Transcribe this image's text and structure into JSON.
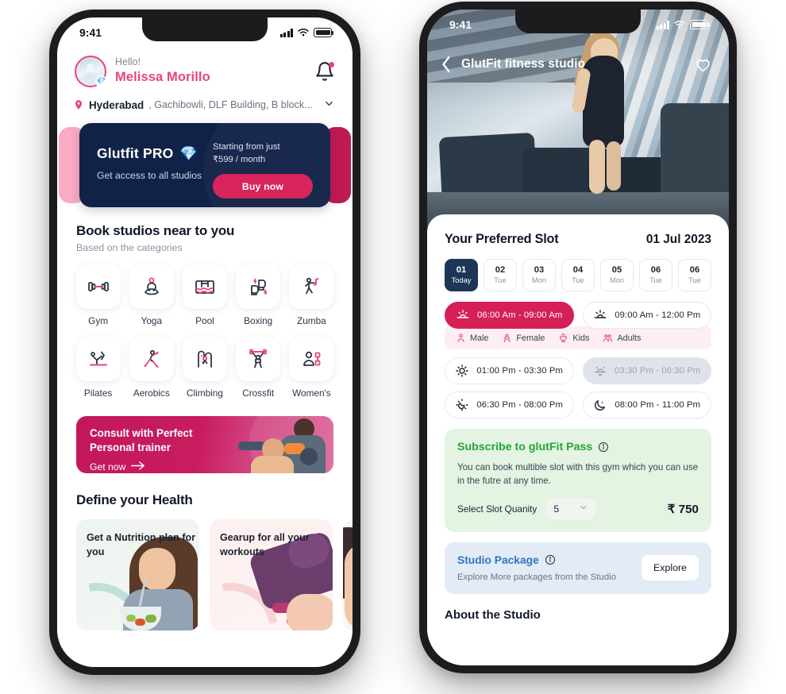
{
  "home": {
    "statusbar": {
      "time": "9:41",
      "signal_icon": "signal-bars-icon",
      "wifi_icon": "wifi-icon",
      "battery_icon": "battery-icon"
    },
    "greeting": {
      "hello": "Hello!",
      "name": "Melissa Morillo",
      "avatar_icon": "avatar",
      "badge_icon": "diamond-badge-icon",
      "bell_icon": "notification-bell-icon"
    },
    "location": {
      "pin_icon": "location-pin-icon",
      "city": "Hyderabad",
      "rest": ", Gachibowli, DLF Building, B block...",
      "chevron_icon": "chevron-down-icon"
    },
    "promo": {
      "title": "Glutfit PRO",
      "emoji": "💎",
      "subtitle": "Get access to all studios",
      "price_line1": "Starting from just",
      "price_line2": "₹599 / month",
      "buy_label": "Buy now"
    },
    "book_section": {
      "title": "Book studios near to you",
      "subtitle": "Based on the categories"
    },
    "categories": [
      {
        "label": "Gym",
        "icon": "dumbbell-icon"
      },
      {
        "label": "Yoga",
        "icon": "yoga-lotus-icon"
      },
      {
        "label": "Pool",
        "icon": "swimming-pool-icon"
      },
      {
        "label": "Boxing",
        "icon": "boxing-gloves-icon"
      },
      {
        "label": "Zumba",
        "icon": "zumba-dance-icon"
      },
      {
        "label": "Pilates",
        "icon": "pilates-icon"
      },
      {
        "label": "Aerobics",
        "icon": "aerobics-icon"
      },
      {
        "label": "Climbing",
        "icon": "climbing-icon"
      },
      {
        "label": "Crossfit",
        "icon": "crossfit-barbell-icon"
      },
      {
        "label": "Women's",
        "icon": "womens-icon"
      }
    ],
    "trainer_banner": {
      "line1": "Consult with Perfect",
      "line2": "Personal trainer",
      "cta": "Get now",
      "arrow_icon": "arrow-right-icon"
    },
    "health_section": {
      "title": "Define your Health"
    },
    "health_cards": [
      {
        "title": "Get a Nutrition plan for you"
      },
      {
        "title": "Gearup for all your workouts"
      },
      {
        "title": ""
      }
    ]
  },
  "studio": {
    "statusbar": {
      "time": "9:41",
      "signal_icon": "signal-bars-icon",
      "wifi_icon": "wifi-icon",
      "battery_icon": "battery-icon"
    },
    "hero": {
      "back_icon": "back-chevron-icon",
      "title": "GlutFit fitness studio",
      "heart_icon": "heart-favorite-icon",
      "carousel_dots": 5,
      "active_dot": 0
    },
    "slot": {
      "title": "Your Preferred Slot",
      "date": "01 Jul 2023"
    },
    "days": [
      {
        "num": "01",
        "day": "Today",
        "active": true
      },
      {
        "num": "02",
        "day": "Tue",
        "active": false
      },
      {
        "num": "03",
        "day": "Mon",
        "active": false
      },
      {
        "num": "04",
        "day": "Tue",
        "active": false
      },
      {
        "num": "05",
        "day": "Mon",
        "active": false
      },
      {
        "num": "06",
        "day": "Tue",
        "active": false
      },
      {
        "num": "06",
        "day": "Tue",
        "active": false
      }
    ],
    "timeslots": [
      {
        "label": "06:00 Am - 09:00 Am",
        "icon": "sunrise-icon",
        "state": "selected"
      },
      {
        "label": "09:00 Am - 12:00 Pm",
        "icon": "sunrise-icon",
        "state": "normal"
      },
      {
        "label": "01:00 Pm - 03:30 Pm",
        "icon": "sun-icon",
        "state": "normal"
      },
      {
        "label": "03:30 Pm - 06:30 Pm",
        "icon": "sunset-icon",
        "state": "disabled"
      },
      {
        "label": "06:30 Pm - 08:00 Pm",
        "icon": "moon-rays-icon",
        "state": "normal"
      },
      {
        "label": "08:00 Pm - 11:00 Pm",
        "icon": "moon-stars-icon",
        "state": "normal"
      }
    ],
    "genders": [
      {
        "label": "Male",
        "icon": "male-icon"
      },
      {
        "label": "Female",
        "icon": "female-icon"
      },
      {
        "label": "Kids",
        "icon": "kids-icon"
      },
      {
        "label": "Adults",
        "icon": "adults-icon"
      }
    ],
    "pass": {
      "title": "Subscribe to glutFit Pass",
      "info_icon": "info-icon",
      "description": "You can book multible slot with this gym which you can use in the futre at any time.",
      "qty_label": "Select Slot Quanity",
      "qty_value": "5",
      "qty_chevron_icon": "chevron-down-icon",
      "price": "₹ 750"
    },
    "package": {
      "title": "Studio Package",
      "info_icon": "info-icon",
      "description": "Explore More packages from the Studio",
      "button": "Explore"
    },
    "about_title": "About the Studio"
  },
  "colors": {
    "brand_pink": "#e6457f",
    "brand_crimson": "#d61e57",
    "navy": "#1d3557",
    "promo_navy": "#112248",
    "green": "#22a53a",
    "blue": "#2f74c0"
  }
}
